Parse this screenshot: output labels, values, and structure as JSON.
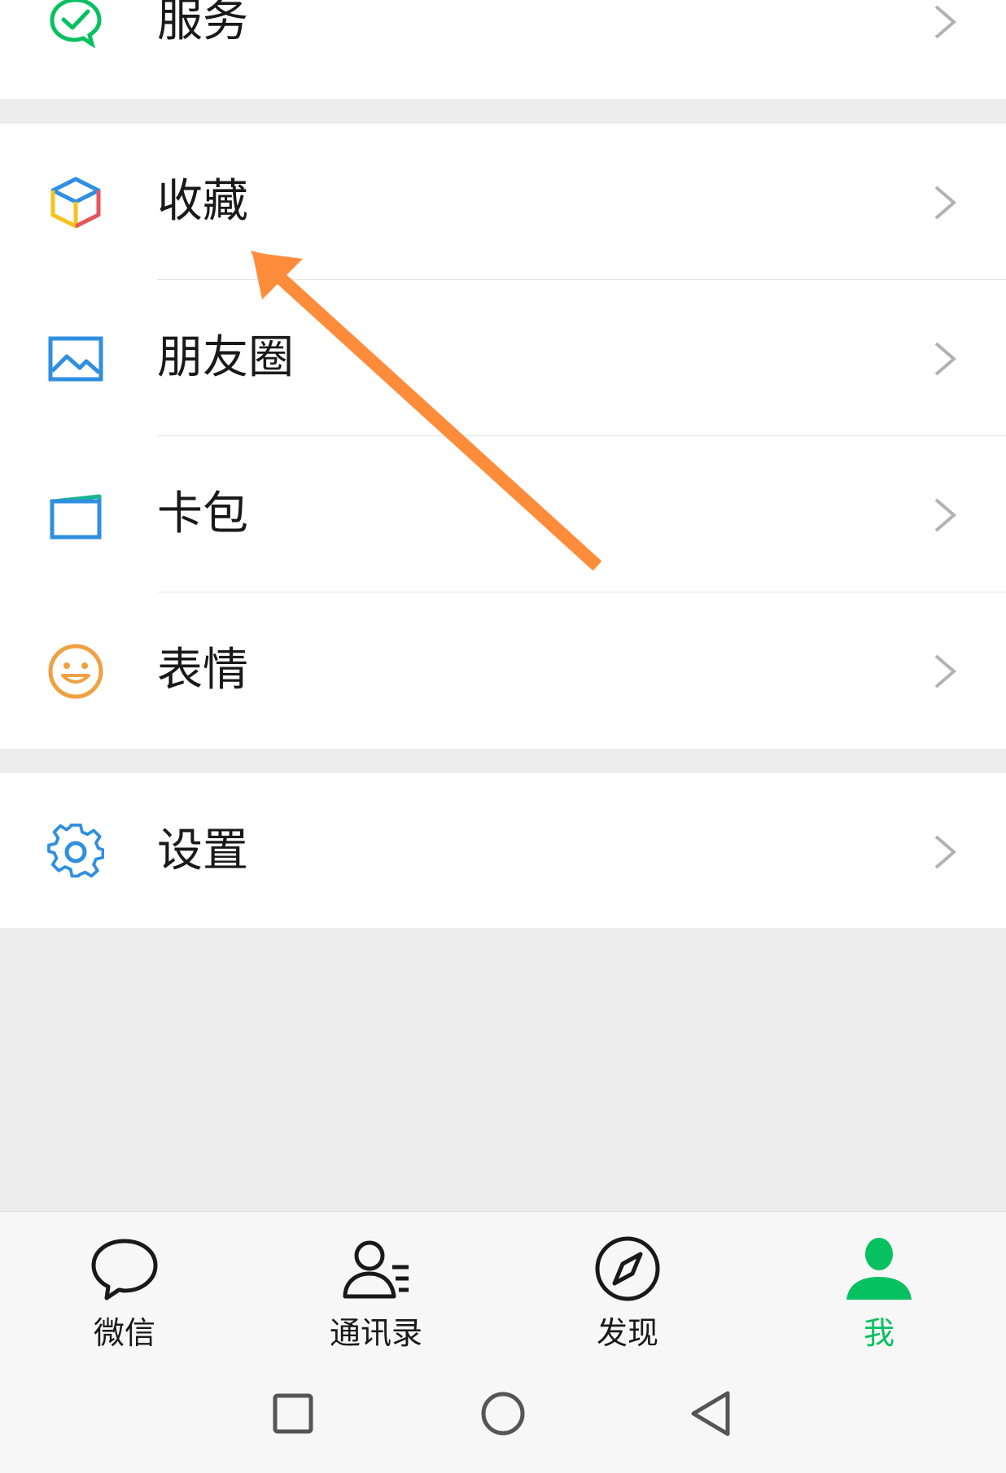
{
  "menu": {
    "service": {
      "label": "服务",
      "icon": "wechat-service-icon"
    },
    "favorites": {
      "label": "收藏",
      "icon": "cube-icon"
    },
    "moments": {
      "label": "朋友圈",
      "icon": "image-frame-icon"
    },
    "cards": {
      "label": "卡包",
      "icon": "card-wallet-icon"
    },
    "stickers": {
      "label": "表情",
      "icon": "smiley-icon"
    },
    "settings": {
      "label": "设置",
      "icon": "gear-icon"
    }
  },
  "tabbar": {
    "chats": {
      "label": "微信",
      "icon": "chat-bubble-icon"
    },
    "contacts": {
      "label": "通讯录",
      "icon": "contacts-icon"
    },
    "discover": {
      "label": "发现",
      "icon": "compass-icon"
    },
    "me": {
      "label": "我",
      "icon": "person-icon",
      "active": true
    }
  },
  "colors": {
    "accent": "#07c160",
    "annotation_arrow": "#ff8c3a",
    "background": "#ededed"
  }
}
